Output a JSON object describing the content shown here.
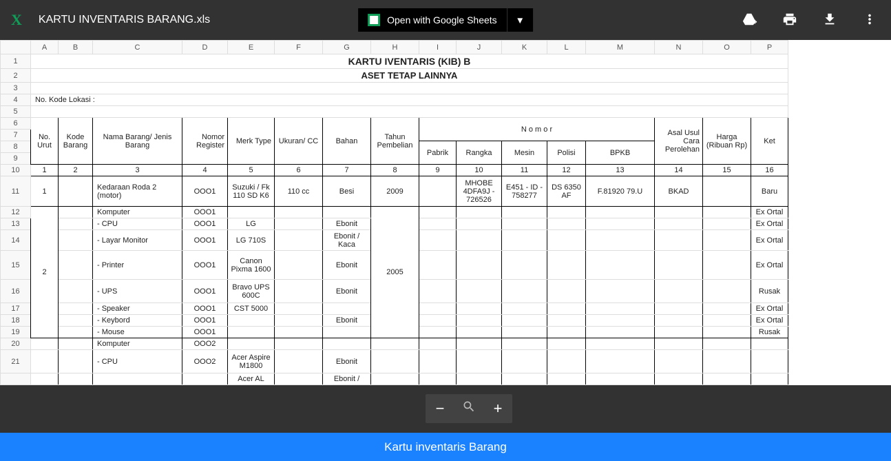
{
  "header": {
    "filename": "KARTU INVENTARIS BARANG.xls",
    "open_with": "Open with Google Sheets"
  },
  "columns": [
    "A",
    "B",
    "C",
    "D",
    "E",
    "F",
    "G",
    "H",
    "I",
    "J",
    "K",
    "L",
    "M",
    "N",
    "O",
    "P"
  ],
  "titles": {
    "main": "KARTU IVENTARIS (KIB) B",
    "sub": "ASET TETAP LAINNYA",
    "kode_lokasi": "No. Kode Lokasi :"
  },
  "head": {
    "no_urut": "No. Urut",
    "kode_barang": "Kode Barang",
    "nama_barang": "Nama Barang/ Jenis Barang",
    "nomor_register": "Nomor Register",
    "merk_type": "Merk Type",
    "ukuran": "Ukuran/ CC",
    "bahan": "Bahan",
    "tahun": "Tahun Pembelian",
    "nomor": "N o m o r",
    "pabrik": "Pabrik",
    "rangka": "Rangka",
    "mesin": "Mesin",
    "polisi": "Polisi",
    "bpkb": "BPKB",
    "asal": "Asal Usul Cara Perolehan",
    "harga": "Harga (Ribuan Rp)",
    "ket": "Ket"
  },
  "numrow": {
    "c1": "1",
    "c2": "2",
    "c3": "3",
    "c4": "4",
    "c5": "5",
    "c6": "6",
    "c7": "7",
    "c8": "8",
    "c9": "9",
    "c10": "10",
    "c11": "11",
    "c12": "12",
    "c13": "13",
    "c14": "14",
    "c15": "15",
    "c16": "16"
  },
  "rows": {
    "r11": {
      "no": "1",
      "nama": "Kedaraan Roda 2 (motor)",
      "reg": "OOO1",
      "type": "Suzuki / Fk 110 SD K6",
      "ukuran": "110 cc",
      "bahan": "Besi",
      "tahun": "2009",
      "rangka": "MHOBE 4DFA9J - 726526",
      "mesin": "E451 - ID - 758277",
      "polisi": "DS 6350 AF",
      "bpkb": "F.81920 79.U",
      "asal": "BKAD",
      "ket": "Baru"
    },
    "r12": {
      "nama": "Komputer",
      "reg": "OOO1",
      "ket": "Ex Ortal"
    },
    "r13": {
      "nama": " - CPU",
      "reg": "OOO1",
      "type": "LG",
      "bahan": "Ebonit",
      "ket": "Ex Ortal"
    },
    "r14": {
      "nama": " - Layar Monitor",
      "reg": "OOO1",
      "type": "LG 710S",
      "bahan": "Ebonit / Kaca",
      "ket": "Ex Ortal"
    },
    "r15": {
      "no": "2",
      "nama": " - Printer",
      "reg": "OOO1",
      "type": "Canon Pixma 1600",
      "bahan": "Ebonit",
      "tahun": "2005",
      "ket": "Ex Ortal"
    },
    "r16": {
      "nama": " - UPS",
      "reg": "OOO1",
      "type": "Bravo UPS 600C",
      "bahan": "Ebonit",
      "ket": "Rusak"
    },
    "r17": {
      "nama": " - Speaker",
      "reg": "OOO1",
      "type": "CST 5000",
      "ket": "Ex Ortal"
    },
    "r18": {
      "nama": " - Keybord",
      "reg": "OOO1",
      "bahan": "Ebonit",
      "ket": "Ex Ortal"
    },
    "r19": {
      "nama": " - Mouse",
      "reg": "OOO1",
      "ket": "Rusak"
    },
    "r20": {
      "nama": "Komputer",
      "reg": "OOO2"
    },
    "r21": {
      "nama": " - CPU",
      "reg": "OOO2",
      "type": "Acer Aspire M1800",
      "bahan": "Ebonit"
    },
    "r22": {
      "type": "Acer AL",
      "bahan": "Ebonit /"
    }
  },
  "bottom": {
    "title": "Kartu inventaris Barang"
  }
}
